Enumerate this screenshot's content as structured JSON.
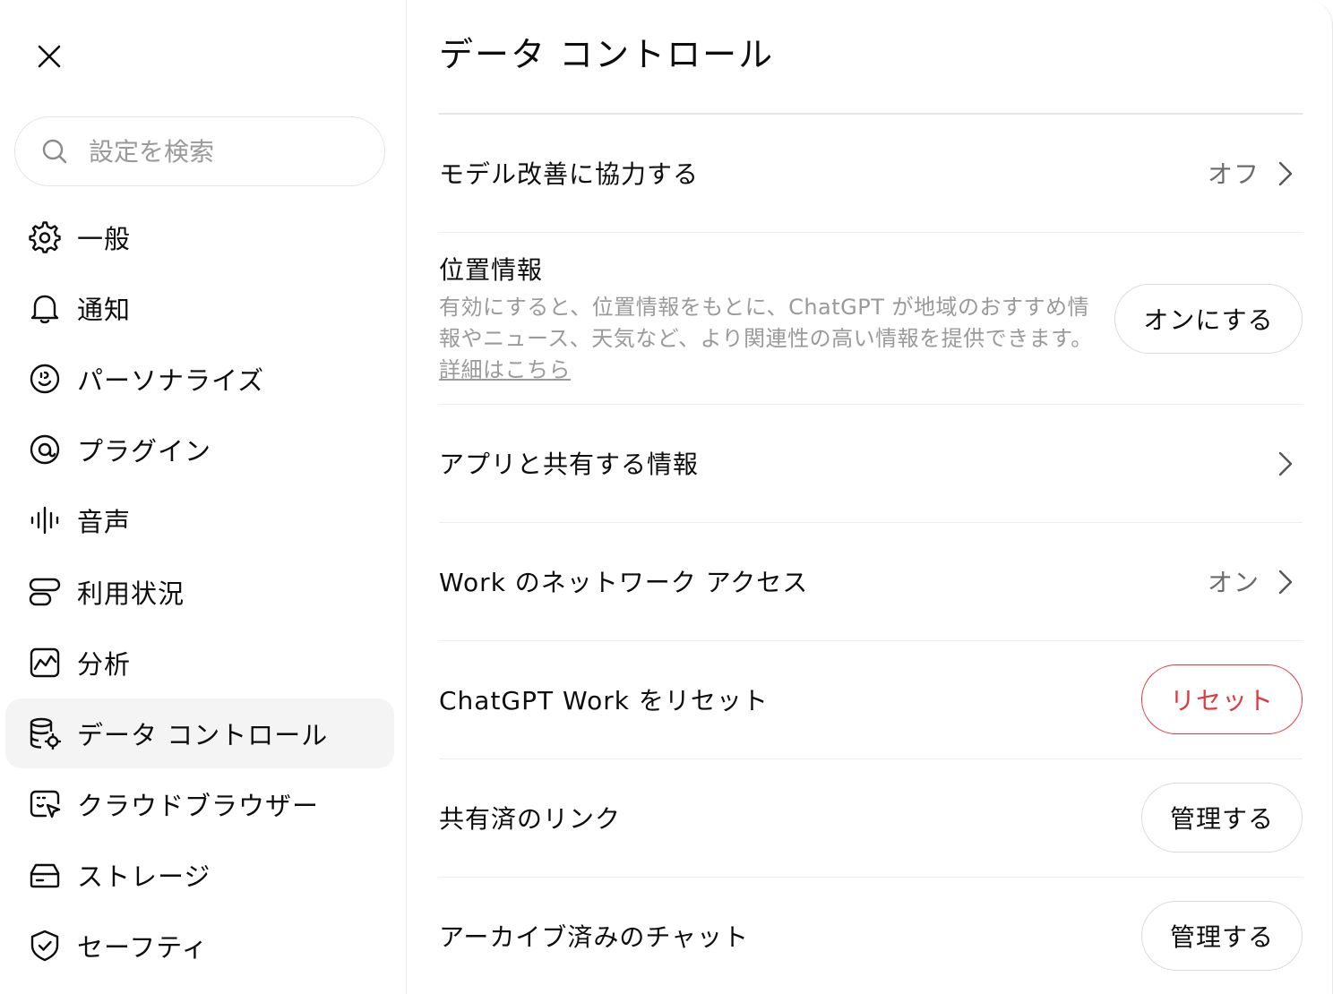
{
  "sidebar": {
    "search": {
      "placeholder": "設定を検索"
    },
    "items": [
      {
        "label": "一般",
        "icon": "gear-icon"
      },
      {
        "label": "通知",
        "icon": "bell-icon"
      },
      {
        "label": "パーソナライズ",
        "icon": "personalize-icon"
      },
      {
        "label": "プラグイン",
        "icon": "plugin-icon"
      },
      {
        "label": "音声",
        "icon": "voice-icon"
      },
      {
        "label": "利用状況",
        "icon": "usage-icon"
      },
      {
        "label": "分析",
        "icon": "analytics-icon"
      },
      {
        "label": "データ コントロール",
        "icon": "database-gear-icon",
        "active": true
      },
      {
        "label": "クラウドブラウザー",
        "icon": "cloud-browser-icon"
      },
      {
        "label": "ストレージ",
        "icon": "storage-icon"
      },
      {
        "label": "セーフティ",
        "icon": "shield-check-icon"
      }
    ]
  },
  "main": {
    "title": "データ コントロール",
    "rows": {
      "model_improve": {
        "label": "モデル改善に協力する",
        "value": "オフ"
      },
      "location": {
        "label": "位置情報",
        "description": "有効にすると、位置情報をもとに、ChatGPT が地域のおすすめ情報やニュース、天気など、より関連性の高い情報を提供できます。",
        "link": "詳細はこちら",
        "button": "オンにする"
      },
      "apps_shared": {
        "label": "アプリと共有する情報"
      },
      "work_network": {
        "label": "Work のネットワーク アクセス",
        "value": "オン"
      },
      "reset_work": {
        "label": "ChatGPT Work をリセット",
        "button": "リセット"
      },
      "shared_links": {
        "label": "共有済のリンク",
        "button": "管理する"
      },
      "archived_chats": {
        "label": "アーカイブ済みのチャット",
        "button": "管理する"
      }
    }
  },
  "colors": {
    "danger": "#e0393e",
    "active_bg": "#f4f4f4",
    "muted_text": "#9a9a9a"
  }
}
